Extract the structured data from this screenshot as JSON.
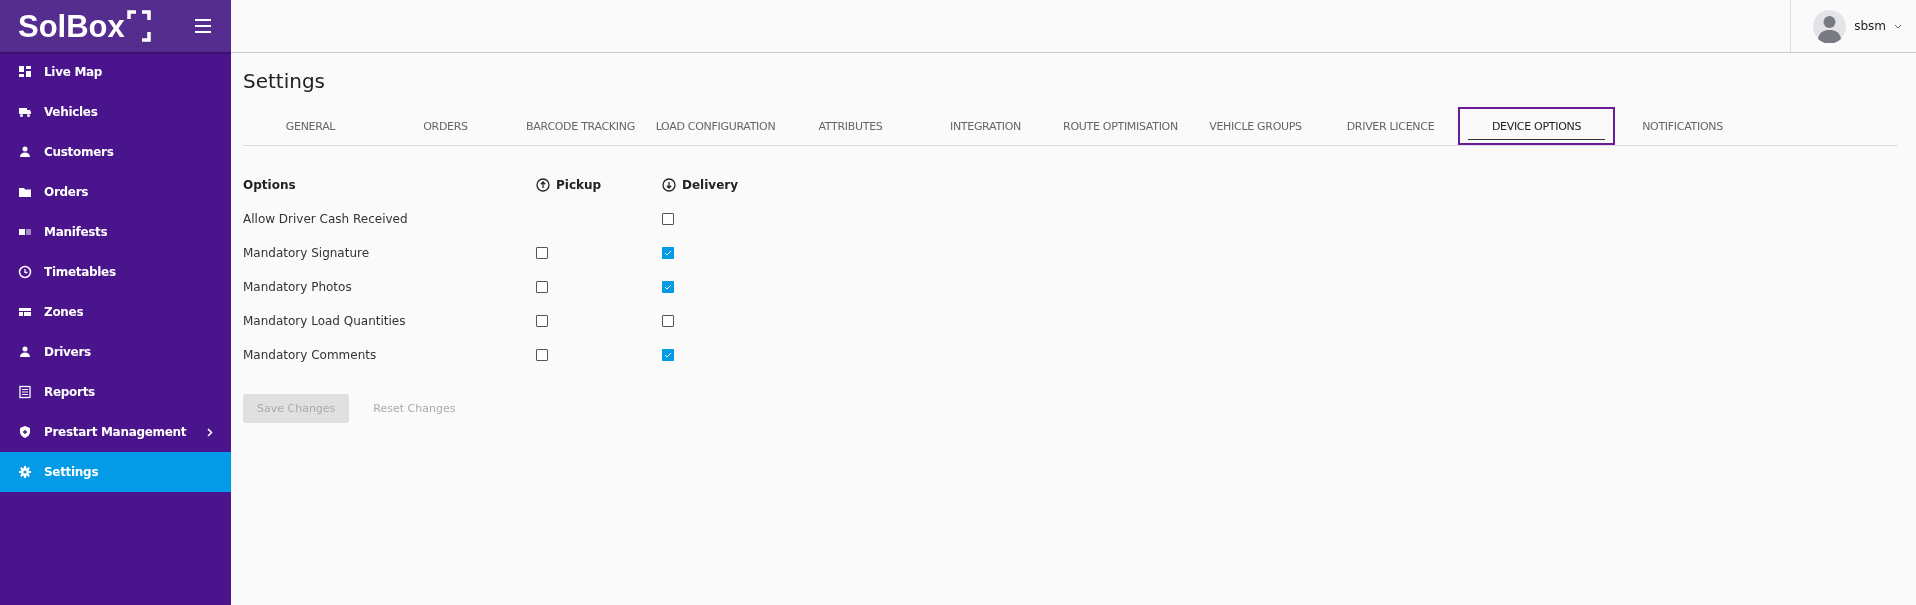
{
  "sidebar": {
    "logo": "SolBox",
    "items": [
      {
        "label": "Live Map",
        "selected": false,
        "has_submenu": false
      },
      {
        "label": "Vehicles",
        "selected": false,
        "has_submenu": false
      },
      {
        "label": "Customers",
        "selected": false,
        "has_submenu": false
      },
      {
        "label": "Orders",
        "selected": false,
        "has_submenu": false
      },
      {
        "label": "Manifests",
        "selected": false,
        "has_submenu": false
      },
      {
        "label": "Timetables",
        "selected": false,
        "has_submenu": false
      },
      {
        "label": "Zones",
        "selected": false,
        "has_submenu": false
      },
      {
        "label": "Drivers",
        "selected": false,
        "has_submenu": false
      },
      {
        "label": "Reports",
        "selected": false,
        "has_submenu": false
      },
      {
        "label": "Prestart Management",
        "selected": false,
        "has_submenu": true
      },
      {
        "label": "Settings",
        "selected": true,
        "has_submenu": false
      }
    ]
  },
  "user": {
    "name": "sbsm"
  },
  "page": {
    "title": "Settings"
  },
  "tabs": [
    {
      "label": "GENERAL",
      "selected": false
    },
    {
      "label": "ORDERS",
      "selected": false
    },
    {
      "label": "BARCODE TRACKING",
      "selected": false
    },
    {
      "label": "LOAD CONFIGURATION",
      "selected": false
    },
    {
      "label": "ATTRIBUTES",
      "selected": false
    },
    {
      "label": "INTEGRATION",
      "selected": false
    },
    {
      "label": "ROUTE OPTIMISATION",
      "selected": false
    },
    {
      "label": "VEHICLE GROUPS",
      "selected": false
    },
    {
      "label": "DRIVER LICENCE",
      "selected": false
    },
    {
      "label": "DEVICE OPTIONS",
      "selected": true
    },
    {
      "label": "NOTIFICATIONS",
      "selected": false
    }
  ],
  "options": {
    "columns": {
      "options": "Options",
      "pickup": "Pickup",
      "delivery": "Delivery"
    },
    "rows": [
      {
        "label": "Allow Driver Cash Received",
        "delivery": {
          "checked": false
        }
      },
      {
        "label": "Mandatory Signature",
        "pickup": {
          "checked": false
        },
        "delivery": {
          "checked": true
        }
      },
      {
        "label": "Mandatory Photos",
        "pickup": {
          "checked": false
        },
        "delivery": {
          "checked": true
        }
      },
      {
        "label": "Mandatory Load Quantities",
        "pickup": {
          "checked": false
        },
        "delivery": {
          "checked": false
        }
      },
      {
        "label": "Mandatory Comments",
        "pickup": {
          "checked": false
        },
        "delivery": {
          "checked": true
        }
      }
    ]
  },
  "buttons": [
    {
      "label": "Save Changes",
      "kind": "filled",
      "disabled": true
    },
    {
      "label": "Reset Changes",
      "kind": "text",
      "disabled": true
    }
  ]
}
